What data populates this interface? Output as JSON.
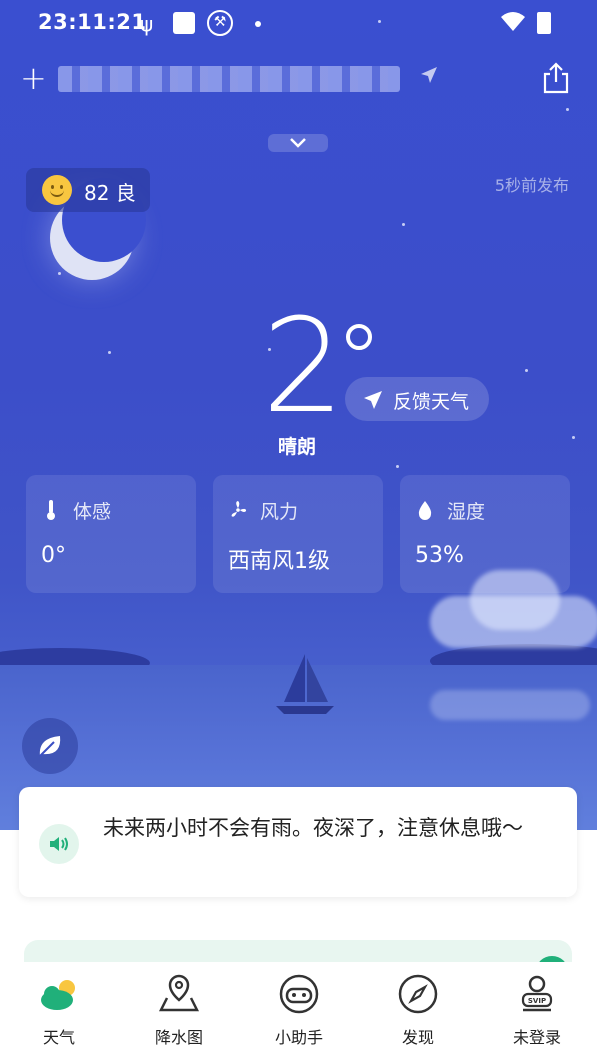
{
  "status_bar": {
    "time": "23:11:21",
    "icons": [
      "usb-icon",
      "app-square-icon",
      "wrench-icon",
      "dot-icon",
      "wifi-icon",
      "battery-icon"
    ]
  },
  "top_bar": {
    "location": "████ ████████ ███",
    "add_icon": "plus-icon",
    "share_icon": "share-icon"
  },
  "air_quality": {
    "value": "82 良"
  },
  "published": "5秒前发布",
  "weather": {
    "temperature": "2",
    "condition": "晴朗"
  },
  "feedback_label": "反馈天气",
  "cards": [
    {
      "label": "体感",
      "value": "0°",
      "icon": "thermometer-icon"
    },
    {
      "label": "风力",
      "value": "西南风1级",
      "icon": "fan-icon"
    },
    {
      "label": "湿度",
      "value": "53%",
      "icon": "droplet-icon"
    }
  ],
  "tip": {
    "text": "未来两小时不会有雨。夜深了，注意休息哦～"
  },
  "tabs": [
    {
      "label": "天气",
      "icon": "weather-icon"
    },
    {
      "label": "降水图",
      "icon": "map-pin-icon"
    },
    {
      "label": "小助手",
      "icon": "assistant-icon"
    },
    {
      "label": "发现",
      "icon": "compass-icon"
    },
    {
      "label": "未登录",
      "icon": "svip-user-icon"
    }
  ],
  "colors": {
    "sky": "#3c4ec9",
    "accent_green": "#20b07a",
    "sun": "#f8c640"
  }
}
